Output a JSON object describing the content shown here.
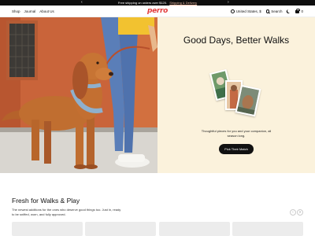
{
  "promo": {
    "text": "Free shipping on orders over $120.",
    "link": "Shipping & Delivery"
  },
  "header": {
    "nav": [
      "Shop",
      "Journal",
      "About Us"
    ],
    "logo": "perro",
    "region": "United States, $",
    "search_label": "Search",
    "cart_count": "0"
  },
  "hero": {
    "title": "Good Days, Better Walks",
    "copy": "Thoughtful pieces for you and your companion, all season long.",
    "cta": "Pick Their Match"
  },
  "fresh": {
    "title": "Fresh for Walks & Play",
    "subtitle": "The newest additions for the ones who deserve good things too. Just in, ready to be sniffed, worn, and fully approved.",
    "prev": "‹",
    "next": "›"
  },
  "colors": {
    "accent": "#e23d3d",
    "panel": "#fbf2dc",
    "promo_bar": "#0e0e0e"
  }
}
